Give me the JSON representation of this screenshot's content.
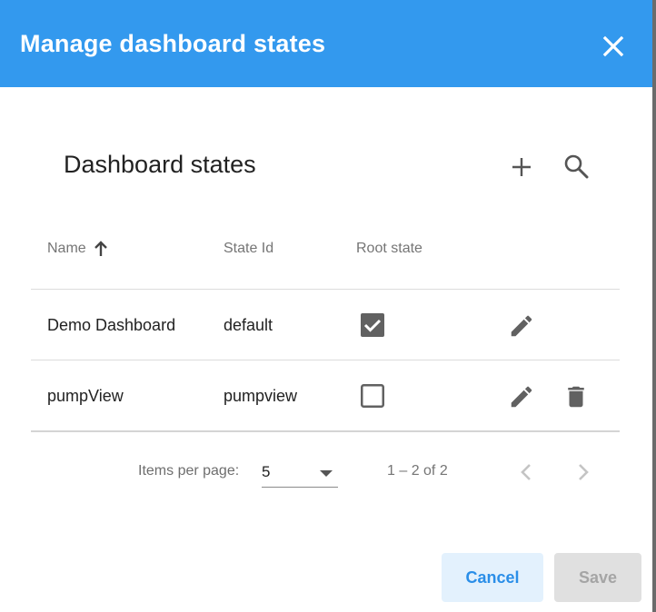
{
  "dialog": {
    "title": "Manage dashboard states",
    "close_icon": "close-icon",
    "header_color": "#3399ee"
  },
  "section": {
    "title": "Dashboard states",
    "add_icon": "add-icon",
    "search_icon": "search-icon"
  },
  "table": {
    "columns": {
      "name": "Name",
      "state_id": "State Id",
      "root_state": "Root state"
    },
    "sort": {
      "column": "Name",
      "direction": "ascending",
      "icon": "arrow-up-icon"
    },
    "rows": [
      {
        "name": "Demo Dashboard",
        "state_id": "default",
        "root_state": true,
        "actions": [
          "edit-icon"
        ]
      },
      {
        "name": "pumpView",
        "state_id": "pumpview",
        "root_state": false,
        "actions": [
          "edit-icon",
          "delete-icon"
        ]
      }
    ]
  },
  "paginator": {
    "items_per_page_label": "Items per page:",
    "items_per_page_value": "5",
    "range_label": "1 – 2 of 2",
    "prev_icon": "chevron-left-icon",
    "next_icon": "chevron-right-icon"
  },
  "footer": {
    "cancel_label": "Cancel",
    "save_label": "Save",
    "accent_color": "#2a8ee8"
  }
}
